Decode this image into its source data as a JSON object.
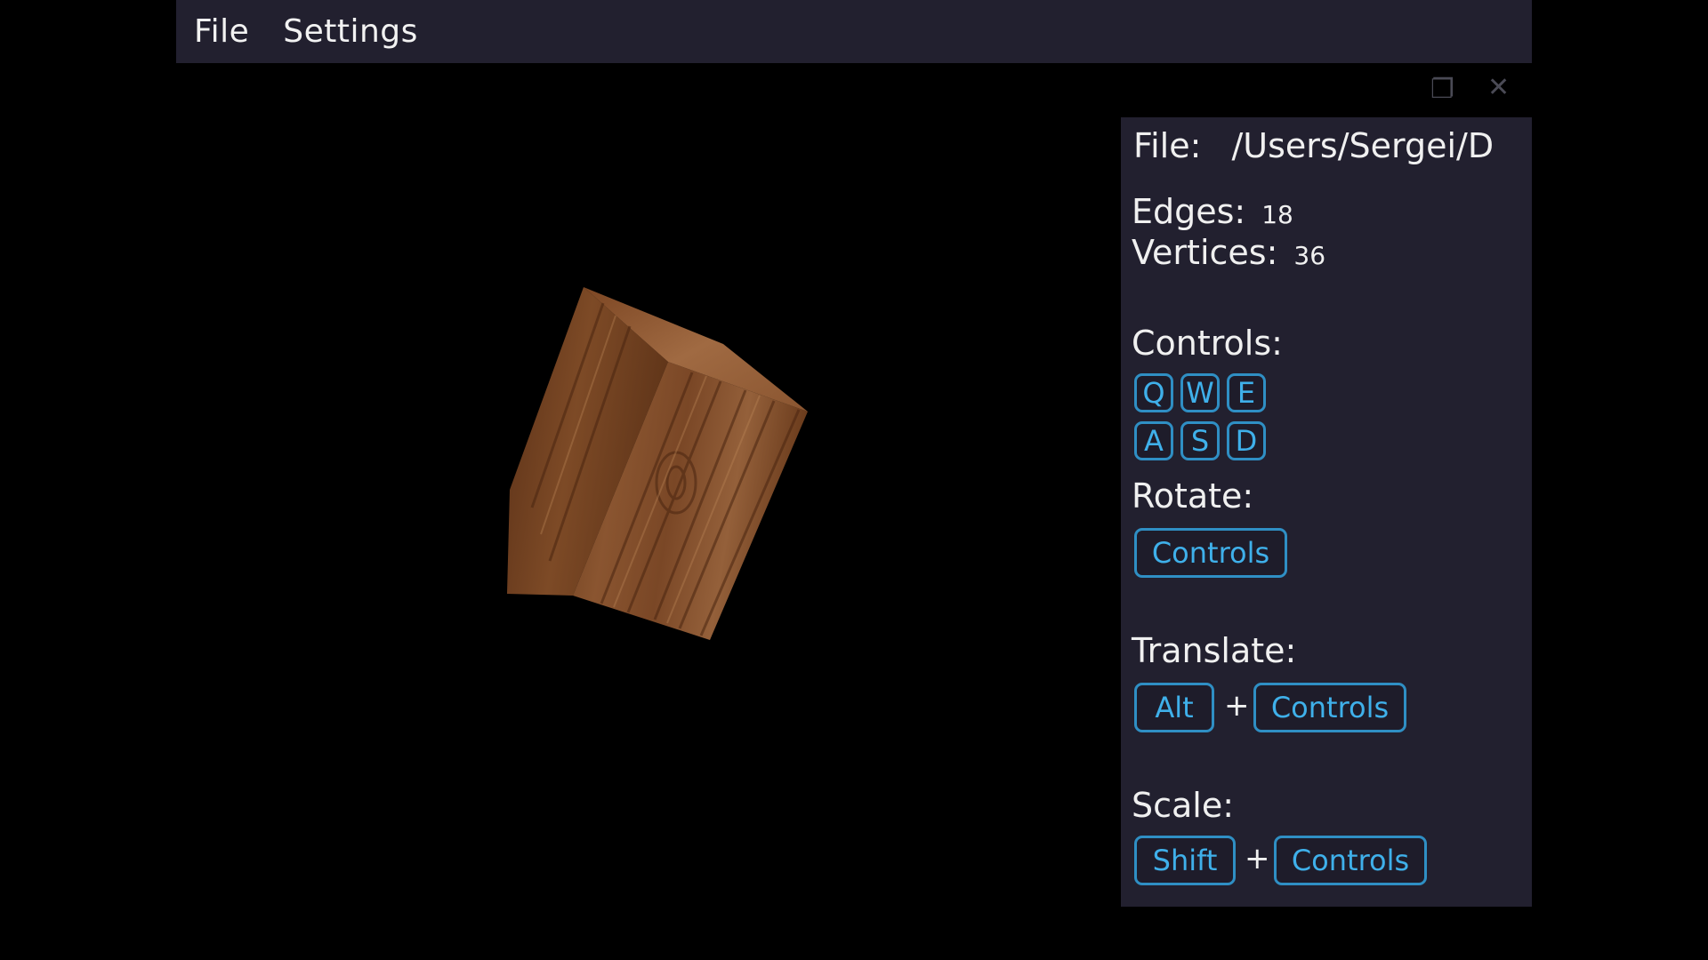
{
  "menu": {
    "file": "File",
    "settings": "Settings"
  },
  "window_controls": {
    "restore_icon": "restore-window-icon",
    "close_icon": "close-icon"
  },
  "model": {
    "texture": "wood"
  },
  "info": {
    "file_label": "File:",
    "file_path": "/Users/Sergei/D",
    "edges_label": "Edges:",
    "edges_value": "18",
    "vertices_label": "Vertices:",
    "vertices_value": "36",
    "controls_label": "Controls:",
    "keys_row1": [
      "Q",
      "W",
      "E"
    ],
    "keys_row2": [
      "A",
      "S",
      "D"
    ],
    "rotate_label": "Rotate:",
    "rotate_key": "Controls",
    "translate_label": "Translate:",
    "translate_modifier": "Alt",
    "translate_key": "Controls",
    "scale_label": "Scale:",
    "scale_modifier": "Shift",
    "scale_key": "Controls",
    "plus": "+"
  },
  "colors": {
    "menubar_bg": "#22202f",
    "panel_bg": "#22202f",
    "key_border": "#2f8fc4",
    "key_text": "#3fb0ea",
    "text": "#f0f0f0"
  }
}
